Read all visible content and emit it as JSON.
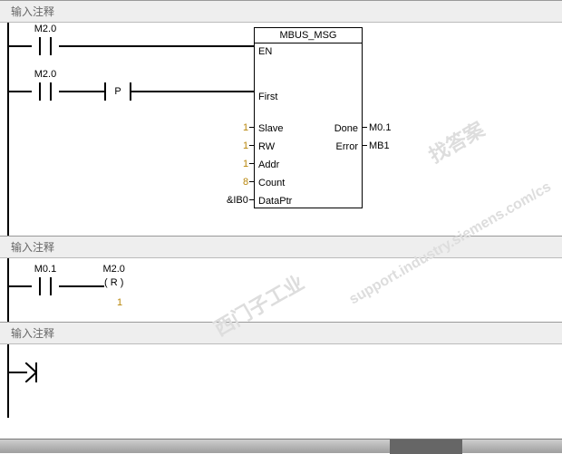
{
  "network1": {
    "title": "输入注释",
    "contact1": "M2.0",
    "contact2": "M2.0",
    "pulse": "P",
    "box": {
      "title": "MBUS_MSG",
      "inputs": {
        "en": "EN",
        "first": "First",
        "slave": "Slave",
        "rw": "RW",
        "addr": "Addr",
        "count": "Count",
        "dataptr": "DataPtr"
      },
      "outputs": {
        "done": "Done",
        "error": "Error"
      },
      "values": {
        "slave": "1",
        "rw": "1",
        "addr": "1",
        "count": "8",
        "dataptr": "&IB0",
        "done": "M0.1",
        "error": "MB1"
      }
    }
  },
  "network2": {
    "title": "输入注释",
    "contact1": "M0.1",
    "coil": {
      "label": "M2.0",
      "type": "R",
      "value": "1"
    }
  },
  "network3": {
    "title": "输入注释"
  },
  "watermark1": "西门子工业",
  "watermark2": "找答案",
  "watermark3": "support.industry.siemens.com/cs"
}
